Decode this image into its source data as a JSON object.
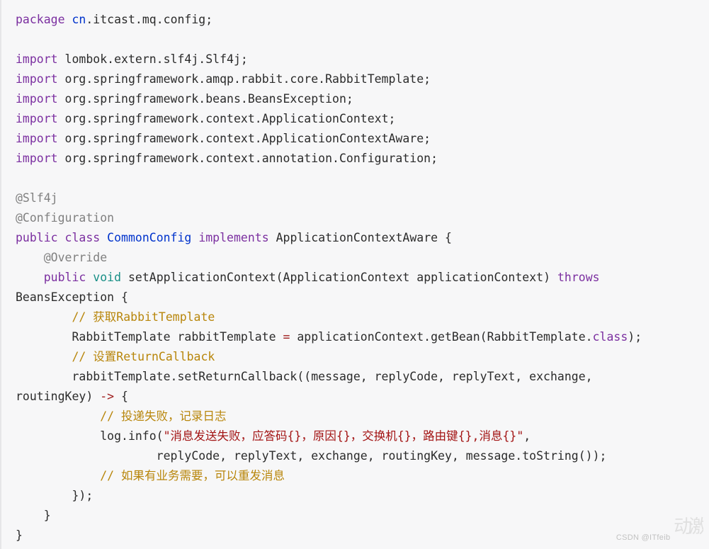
{
  "editor": {
    "language": "java",
    "background_color": "#f7f7f8",
    "default_text_color": "#2b2b2b",
    "syntax_colors": {
      "keyword": "#7b2fa0",
      "type_name": "#0033cc",
      "annotation": "#808080",
      "comment": "#b8860b",
      "string": "#a31515",
      "operator": "#9e1b1b",
      "primitive": "#188f86",
      "plain": "#2b2b2b"
    },
    "lines": [
      {
        "id": "l1",
        "tokens": [
          {
            "t": "package",
            "c": "kw"
          },
          {
            "t": " ",
            "c": "plain"
          },
          {
            "t": "cn",
            "c": "type"
          },
          {
            "t": ".itcast.mq.config;",
            "c": "plain"
          }
        ]
      },
      {
        "id": "l2",
        "tokens": []
      },
      {
        "id": "l3",
        "tokens": [
          {
            "t": "import",
            "c": "kw"
          },
          {
            "t": " lombok.extern.slf4j.Slf4j;",
            "c": "plain"
          }
        ]
      },
      {
        "id": "l4",
        "tokens": [
          {
            "t": "import",
            "c": "kw"
          },
          {
            "t": " org.springframework.amqp.rabbit.core.RabbitTemplate;",
            "c": "plain"
          }
        ]
      },
      {
        "id": "l5",
        "tokens": [
          {
            "t": "import",
            "c": "kw"
          },
          {
            "t": " org.springframework.beans.BeansException;",
            "c": "plain"
          }
        ]
      },
      {
        "id": "l6",
        "tokens": [
          {
            "t": "import",
            "c": "kw"
          },
          {
            "t": " org.springframework.context.ApplicationContext;",
            "c": "plain"
          }
        ]
      },
      {
        "id": "l7",
        "tokens": [
          {
            "t": "import",
            "c": "kw"
          },
          {
            "t": " org.springframework.context.ApplicationContextAware;",
            "c": "plain"
          }
        ]
      },
      {
        "id": "l8",
        "tokens": [
          {
            "t": "import",
            "c": "kw"
          },
          {
            "t": " org.springframework.context.annotation.Configuration;",
            "c": "plain"
          }
        ]
      },
      {
        "id": "l9",
        "tokens": []
      },
      {
        "id": "l10",
        "tokens": [
          {
            "t": "@Slf4j",
            "c": "anno"
          }
        ]
      },
      {
        "id": "l11",
        "tokens": [
          {
            "t": "@Configuration",
            "c": "anno"
          }
        ]
      },
      {
        "id": "l12",
        "tokens": [
          {
            "t": "public",
            "c": "kw"
          },
          {
            "t": " ",
            "c": "plain"
          },
          {
            "t": "class",
            "c": "kw"
          },
          {
            "t": " ",
            "c": "plain"
          },
          {
            "t": "CommonConfig",
            "c": "type"
          },
          {
            "t": " ",
            "c": "plain"
          },
          {
            "t": "implements",
            "c": "kw"
          },
          {
            "t": " ApplicationContextAware {",
            "c": "plain"
          }
        ]
      },
      {
        "id": "l13",
        "tokens": [
          {
            "t": "    ",
            "c": "plain"
          },
          {
            "t": "@Override",
            "c": "anno"
          }
        ]
      },
      {
        "id": "l14",
        "tokens": [
          {
            "t": "    ",
            "c": "plain"
          },
          {
            "t": "public",
            "c": "kw"
          },
          {
            "t": " ",
            "c": "plain"
          },
          {
            "t": "void",
            "c": "void"
          },
          {
            "t": " setApplicationContext(ApplicationContext applicationContext) ",
            "c": "plain"
          },
          {
            "t": "throws",
            "c": "kw"
          }
        ]
      },
      {
        "id": "l15",
        "tokens": [
          {
            "t": "BeansException {",
            "c": "plain"
          }
        ]
      },
      {
        "id": "l16",
        "tokens": [
          {
            "t": "        ",
            "c": "plain"
          },
          {
            "t": "// 获取RabbitTemplate",
            "c": "comment"
          }
        ]
      },
      {
        "id": "l17",
        "tokens": [
          {
            "t": "        RabbitTemplate rabbitTemplate ",
            "c": "plain"
          },
          {
            "t": "=",
            "c": "op"
          },
          {
            "t": " applicationContext.getBean(RabbitTemplate.",
            "c": "plain"
          },
          {
            "t": "class",
            "c": "kw"
          },
          {
            "t": ");",
            "c": "plain"
          }
        ]
      },
      {
        "id": "l18",
        "tokens": [
          {
            "t": "        ",
            "c": "plain"
          },
          {
            "t": "// 设置ReturnCallback",
            "c": "comment"
          }
        ]
      },
      {
        "id": "l19",
        "tokens": [
          {
            "t": "        rabbitTemplate.setReturnCallback((message, replyCode, replyText, exchange,",
            "c": "plain"
          }
        ]
      },
      {
        "id": "l20",
        "tokens": [
          {
            "t": "routingKey) ",
            "c": "plain"
          },
          {
            "t": "->",
            "c": "op"
          },
          {
            "t": " {",
            "c": "plain"
          }
        ]
      },
      {
        "id": "l21",
        "tokens": [
          {
            "t": "            ",
            "c": "plain"
          },
          {
            "t": "// 投递失败，记录日志",
            "c": "comment"
          }
        ]
      },
      {
        "id": "l22",
        "tokens": [
          {
            "t": "            log.info(",
            "c": "plain"
          },
          {
            "t": "\"消息发送失败，应答码{}，原因{}，交换机{}，路由键{},消息{}\"",
            "c": "string"
          },
          {
            "t": ",",
            "c": "plain"
          }
        ]
      },
      {
        "id": "l23",
        "tokens": [
          {
            "t": "                    replyCode, replyText, exchange, routingKey, message.toString());",
            "c": "plain"
          }
        ]
      },
      {
        "id": "l24",
        "tokens": [
          {
            "t": "            ",
            "c": "plain"
          },
          {
            "t": "// 如果有业务需要，可以重发消息",
            "c": "comment"
          }
        ]
      },
      {
        "id": "l25",
        "tokens": [
          {
            "t": "        });",
            "c": "plain"
          }
        ]
      },
      {
        "id": "l26",
        "tokens": [
          {
            "t": "    }",
            "c": "plain"
          }
        ]
      },
      {
        "id": "l27",
        "tokens": [
          {
            "t": "}",
            "c": "plain"
          }
        ]
      }
    ]
  },
  "watermark": {
    "text": "CSDN @ITfeib",
    "glyphs": "激动"
  }
}
